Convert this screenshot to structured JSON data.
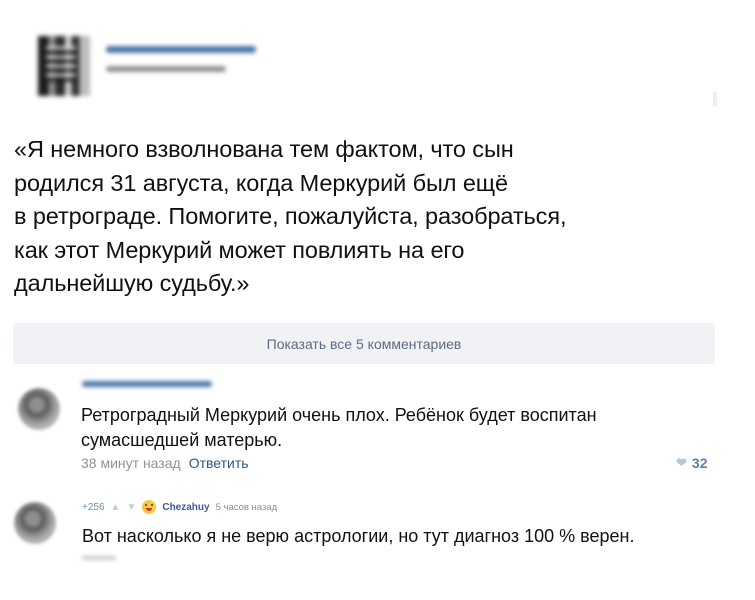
{
  "post": {
    "quote_lines": [
      "«Я немного взволнована тем фактом, что сын",
      "родился 31 августа, когда Меркурий был ещё",
      "в ретрограде. Помогите, пожалуйста, разобраться,",
      "как этот Меркурий может повлиять на его",
      "дальнейшую судьбу.»"
    ]
  },
  "show_comments": {
    "label": "Показать все 5 комментариев"
  },
  "comment1": {
    "text_lines": [
      "Ретроградный Меркурий очень плох. Ребёнок будет воспитан",
      "сумасшедшей матерью."
    ],
    "time": "38 минут назад",
    "reply": "Ответить",
    "likes": "32",
    "icons": {
      "like": "heart-icon"
    }
  },
  "comment2": {
    "score": "+256",
    "author": "Chezahuy",
    "time": "5 часов назад",
    "text": "Вот насколько я не верю астрологии, но тут диагноз 100 % верен.",
    "icons": {
      "up": "upvote-icon",
      "down": "downvote-icon",
      "emoji": "grimace-emoji-icon"
    }
  }
}
